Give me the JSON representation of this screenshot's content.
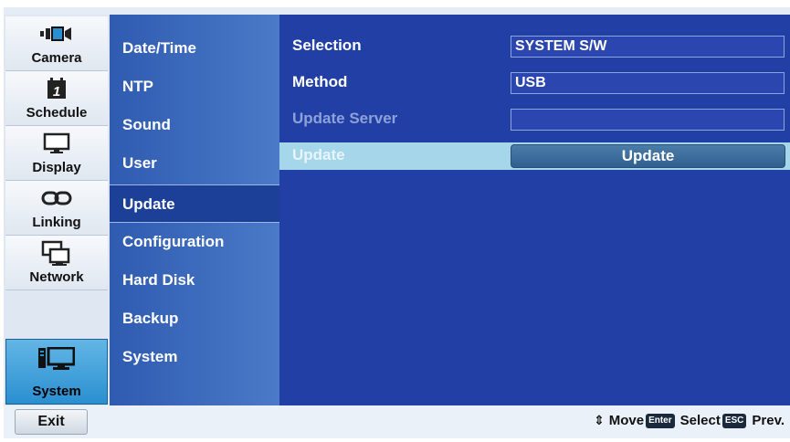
{
  "categories": [
    {
      "label": "Camera",
      "icon": "camera-icon"
    },
    {
      "label": "Schedule",
      "icon": "calendar-icon"
    },
    {
      "label": "Display",
      "icon": "monitor-icon"
    },
    {
      "label": "Linking",
      "icon": "chain-link-icon"
    },
    {
      "label": "Network",
      "icon": "network-icon"
    },
    {
      "label": "System",
      "icon": "system-icon",
      "active": true
    }
  ],
  "schedule_icon_text": "1",
  "submenu": [
    {
      "label": "Date/Time"
    },
    {
      "label": "NTP"
    },
    {
      "label": "Sound"
    },
    {
      "label": "User"
    },
    {
      "label": "Update",
      "selected": true
    },
    {
      "label": "Configuration"
    },
    {
      "label": "Hard Disk"
    },
    {
      "label": "Backup"
    },
    {
      "label": "System"
    }
  ],
  "settings": {
    "selection": {
      "label": "Selection",
      "value": "SYSTEM S/W"
    },
    "method": {
      "label": "Method",
      "value": "USB"
    },
    "update_server": {
      "label": "Update Server",
      "value": ""
    },
    "update": {
      "label": "Update",
      "button": "Update"
    }
  },
  "footer": {
    "exit": "Exit",
    "move": "Move",
    "enter_key": "Enter",
    "select": "Select",
    "esc_key": "ESC",
    "prev": "Prev."
  },
  "colors": {
    "submenu_bg": "#2f5bb0",
    "content_bg": "#223fa6",
    "highlight_row": "#a6d6ea",
    "active_category": "#2a8fd0"
  }
}
